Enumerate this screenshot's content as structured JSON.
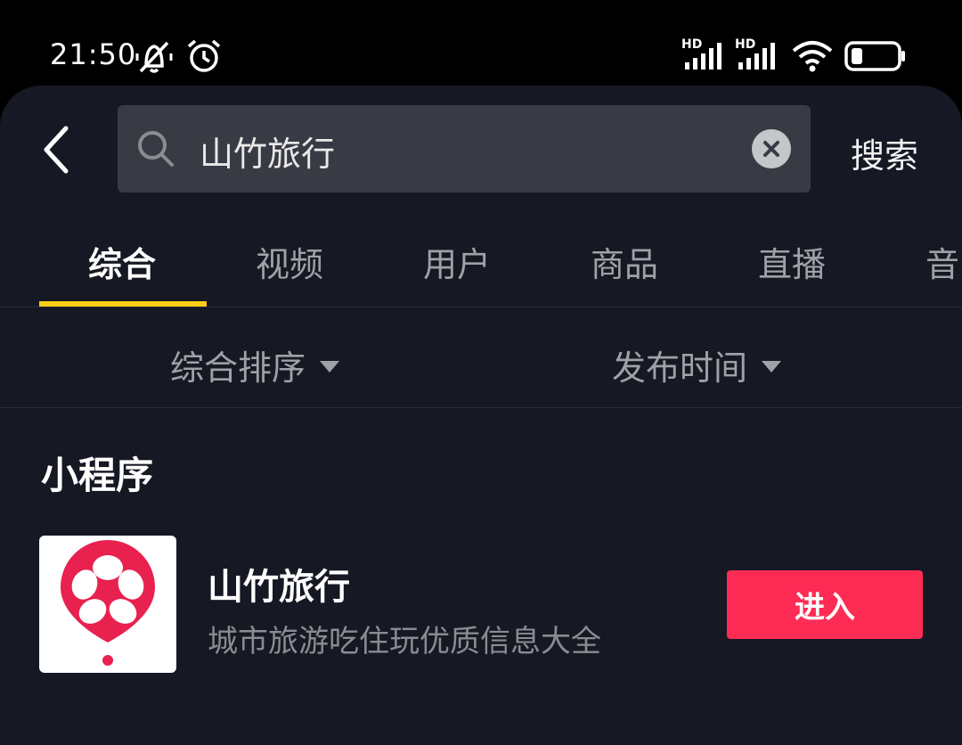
{
  "status_bar": {
    "time": "21:50",
    "icons": [
      "mute-icon",
      "alarm-icon",
      "hd-signal-icon",
      "hd-signal-icon",
      "wifi-icon",
      "battery-icon"
    ],
    "signal_label_1": "HD",
    "signal_label_2": "HD"
  },
  "search": {
    "query": "山竹旅行",
    "submit_label": "搜索"
  },
  "tabs": [
    "综合",
    "视频",
    "用户",
    "商品",
    "直播",
    "音"
  ],
  "active_tab_index": 0,
  "filters": {
    "sort_label": "综合排序",
    "time_label": "发布时间"
  },
  "section": {
    "title": "小程序"
  },
  "mini_program": {
    "name": "山竹旅行",
    "description": "城市旅游吃住玩优质信息大全",
    "enter_label": "进入"
  },
  "colors": {
    "accent_underline": "#face15",
    "enter_button": "#fe2c55",
    "panel_bg": "#161823",
    "search_bg": "#393b44"
  }
}
